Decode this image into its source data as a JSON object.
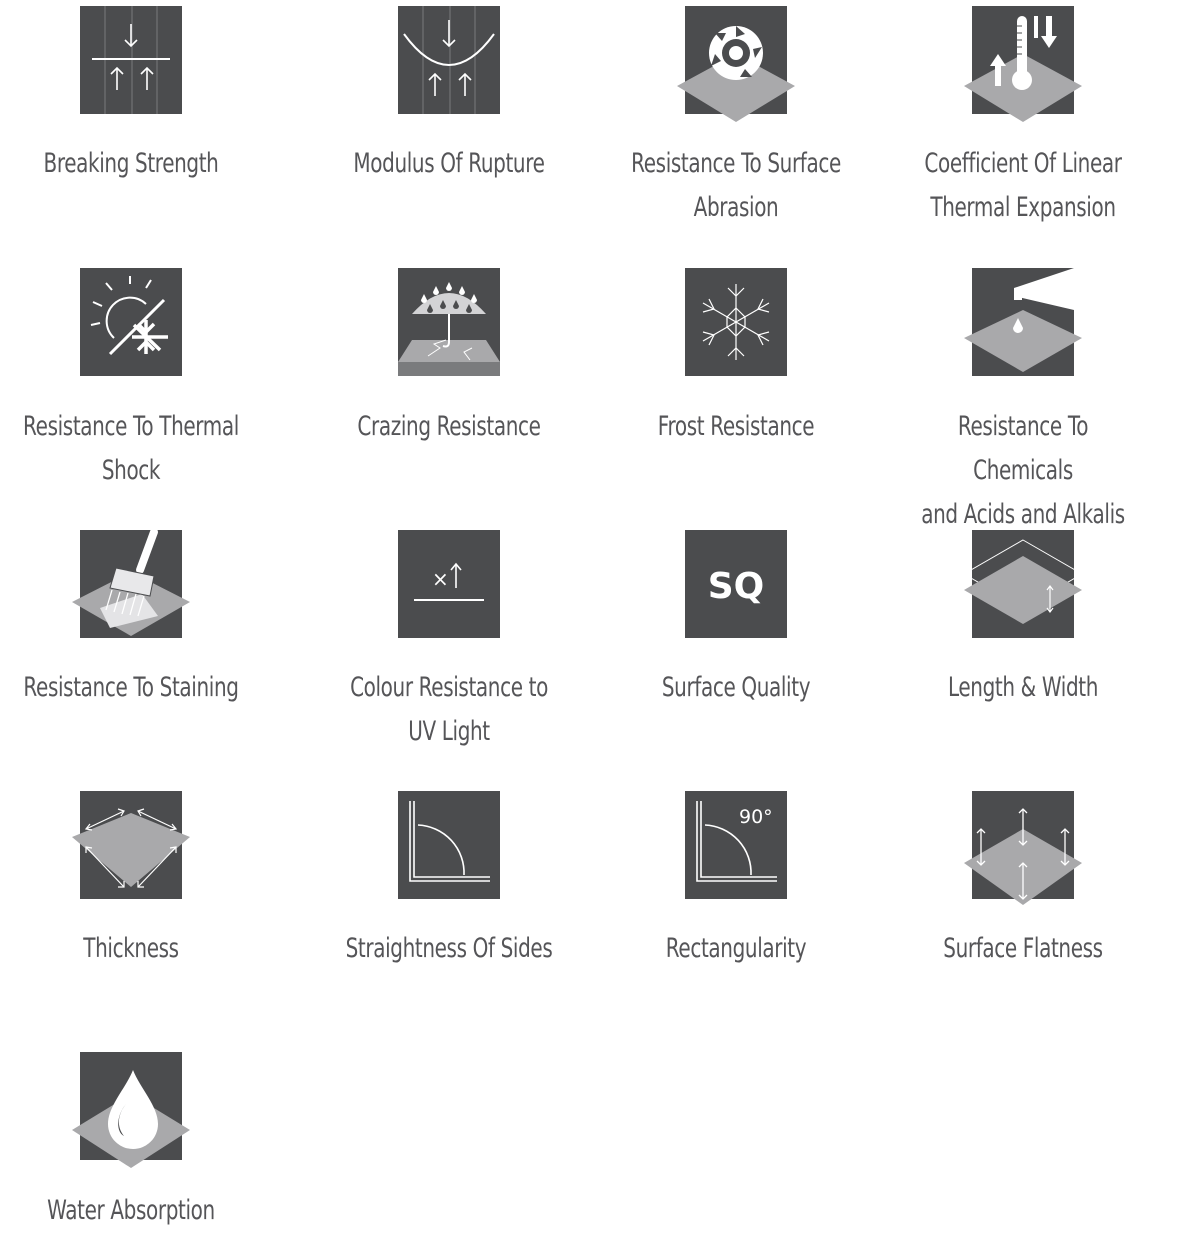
{
  "colors": {
    "tile": "#4b4c4e",
    "diamond": "#a9a9ab",
    "stroke": "#ffffff",
    "label": "#555558"
  },
  "icons": [
    {
      "label": "Breaking Strength",
      "icon": "breaking-strength-icon"
    },
    {
      "label": "Modulus Of Rupture",
      "icon": "modulus-of-rupture-icon"
    },
    {
      "label": "Resistance To Surface\nAbrasion",
      "icon": "surface-abrasion-icon"
    },
    {
      "label": "Coefficient Of Linear\nThermal Expansion",
      "icon": "thermal-expansion-icon"
    },
    {
      "label": "Resistance To Thermal\nShock",
      "icon": "thermal-shock-icon"
    },
    {
      "label": "Crazing Resistance",
      "icon": "crazing-resistance-icon"
    },
    {
      "label": "Frost Resistance",
      "icon": "frost-resistance-icon"
    },
    {
      "label": "Resistance To Chemicals\nand Acids and Alkalis",
      "icon": "chemical-resistance-icon"
    },
    {
      "label": "Resistance To Staining",
      "icon": "staining-resistance-icon"
    },
    {
      "label": "Colour Resistance to\nUV Light",
      "icon": "uv-light-icon"
    },
    {
      "label": "Surface Quality",
      "icon": "surface-quality-icon",
      "icon_text": "SQ"
    },
    {
      "label": "Length & Width",
      "icon": "length-width-icon"
    },
    {
      "label": "Thickness",
      "icon": "thickness-icon"
    },
    {
      "label": "Straightness Of Sides",
      "icon": "straightness-icon"
    },
    {
      "label": "Rectangularity",
      "icon": "rectangularity-icon",
      "icon_text": "90°"
    },
    {
      "label": "Surface Flatness",
      "icon": "surface-flatness-icon"
    },
    {
      "label": "Water Absorption",
      "icon": "water-absorption-icon"
    }
  ]
}
